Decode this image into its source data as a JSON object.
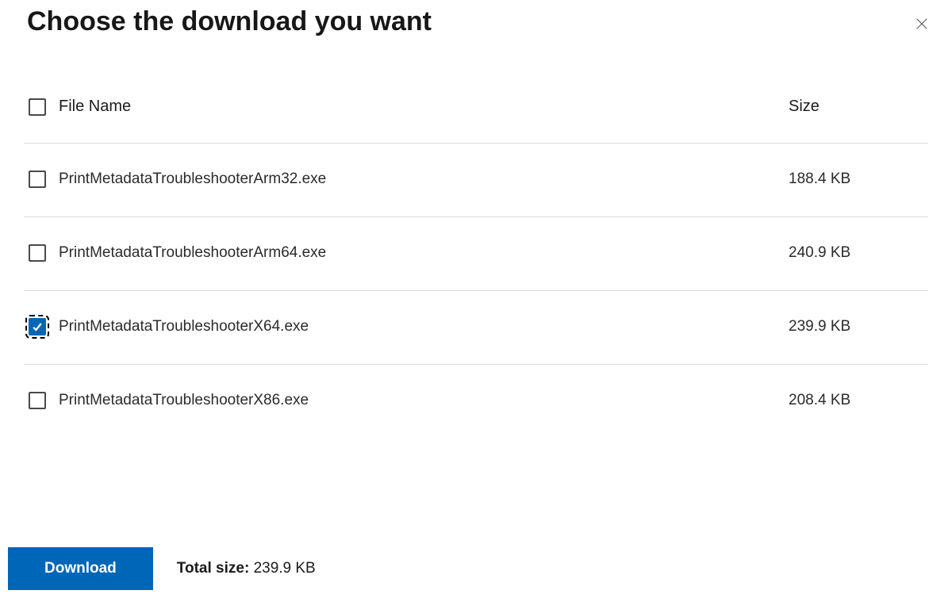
{
  "dialog": {
    "title": "Choose the download you want"
  },
  "table": {
    "header": {
      "fileName": "File Name",
      "size": "Size"
    },
    "rows": [
      {
        "name": "PrintMetadataTroubleshooterArm32.exe",
        "size": "188.4 KB",
        "checked": false,
        "focused": false
      },
      {
        "name": "PrintMetadataTroubleshooterArm64.exe",
        "size": "240.9 KB",
        "checked": false,
        "focused": false
      },
      {
        "name": "PrintMetadataTroubleshooterX64.exe",
        "size": "239.9 KB",
        "checked": true,
        "focused": true
      },
      {
        "name": "PrintMetadataTroubleshooterX86.exe",
        "size": "208.4 KB",
        "checked": false,
        "focused": false
      }
    ]
  },
  "footer": {
    "downloadLabel": "Download",
    "totalSizeLabel": "Total size:",
    "totalSizeValue": "239.9 KB"
  }
}
